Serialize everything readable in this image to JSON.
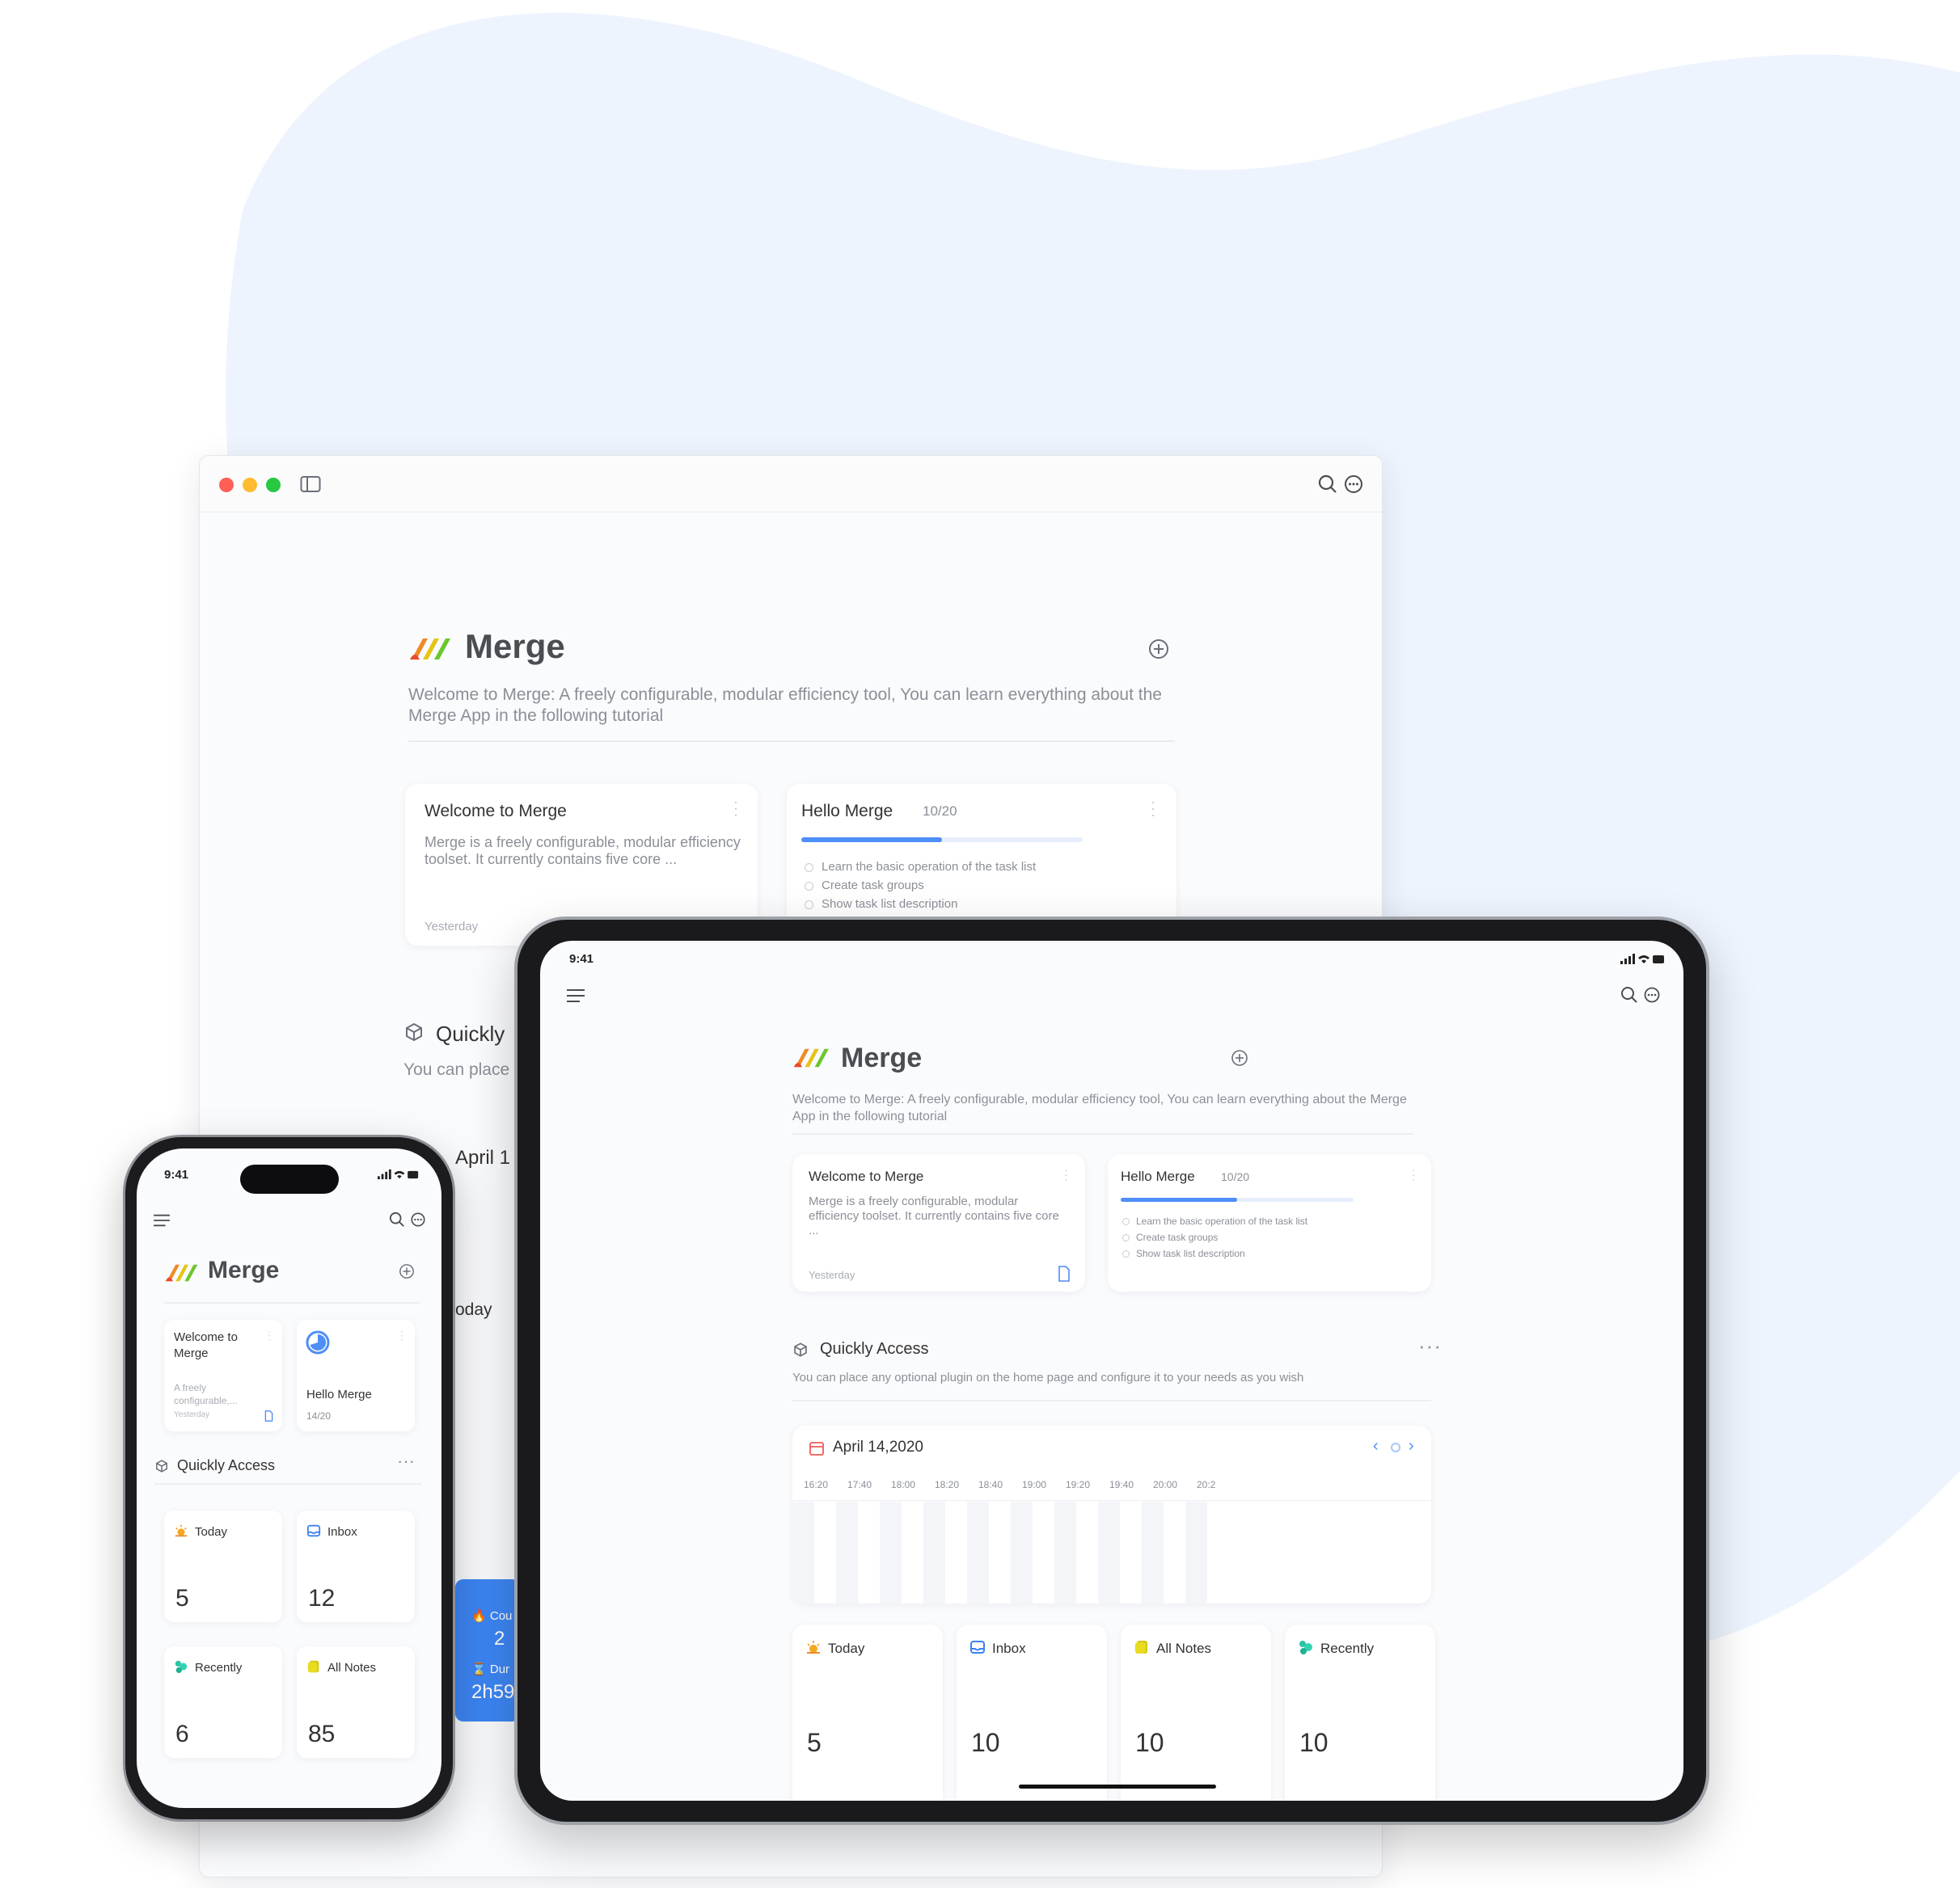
{
  "brand": {
    "name": "Merge",
    "accent": "#4e8ef7",
    "traffic_lights": [
      "#ff5f57",
      "#febc2e",
      "#28c840"
    ]
  },
  "mac": {
    "title": "Merge",
    "description": "Welcome to Merge: A freely configurable, modular efficiency tool, You can learn everything about the Merge App in the following tutorial",
    "welcome_card": {
      "title": "Welcome to Merge",
      "body": "Merge is a freely configurable, modular efficiency toolset. It currently contains five core ...",
      "date": "Yesterday"
    },
    "task_card": {
      "title": "Hello Merge",
      "count": "10/20",
      "progress": 0.5,
      "items": [
        "Learn the basic operation of the task list",
        "Create task groups",
        "Show task list description"
      ]
    },
    "quick_title": "Quickly",
    "quick_desc": "You can place",
    "calendar_fragment": "April 1",
    "today_fragment": "oday",
    "focus": {
      "label1": "Cou",
      "value1": "2",
      "label2": "Dur",
      "value2": "2h59"
    }
  },
  "tablet": {
    "status_time": "9:41",
    "title": "Merge",
    "description": "Welcome to Merge: A freely configurable, modular efficiency tool, You can learn everything about the Merge App in the following tutorial",
    "welcome_card": {
      "title": "Welcome to Merge",
      "body": "Merge is a freely configurable, modular efficiency toolset. It currently contains five core ...",
      "date": "Yesterday"
    },
    "task_card": {
      "title": "Hello Merge",
      "count": "10/20",
      "progress": 0.5,
      "items": [
        "Learn the basic operation of the task list",
        "Create task groups",
        "Show task list description"
      ]
    },
    "quick": {
      "title": "Quickly Access",
      "desc": "You can place any optional plugin on the home page and configure it to your needs as you wish"
    },
    "calendar": {
      "date": "April 14,2020",
      "times": [
        "16:20",
        "17:40",
        "18:00",
        "18:20",
        "18:40",
        "19:00",
        "19:20",
        "19:40",
        "20:00",
        "20:2"
      ]
    },
    "tiles": [
      {
        "label": "Today",
        "value": "5",
        "icon": "sun-icon"
      },
      {
        "label": "Inbox",
        "value": "10",
        "icon": "inbox-icon"
      },
      {
        "label": "All Notes",
        "value": "10",
        "icon": "notes-icon"
      },
      {
        "label": "Recently",
        "value": "10",
        "icon": "recent-icon"
      }
    ]
  },
  "phone": {
    "status_time": "9:41",
    "title": "Merge",
    "welcome_card": {
      "title": "Welcome to Merge",
      "body": "A freely configurable,...",
      "date": "Yesterday"
    },
    "task_card": {
      "title": "Hello Merge",
      "count": "14/20"
    },
    "quick_title": "Quickly Access",
    "tiles": [
      {
        "label": "Today",
        "value": "5",
        "icon": "sun-icon"
      },
      {
        "label": "Inbox",
        "value": "12",
        "icon": "inbox-icon"
      },
      {
        "label": "Recently",
        "value": "6",
        "icon": "recent-icon"
      },
      {
        "label": "All Notes",
        "value": "85",
        "icon": "notes-icon"
      }
    ]
  }
}
